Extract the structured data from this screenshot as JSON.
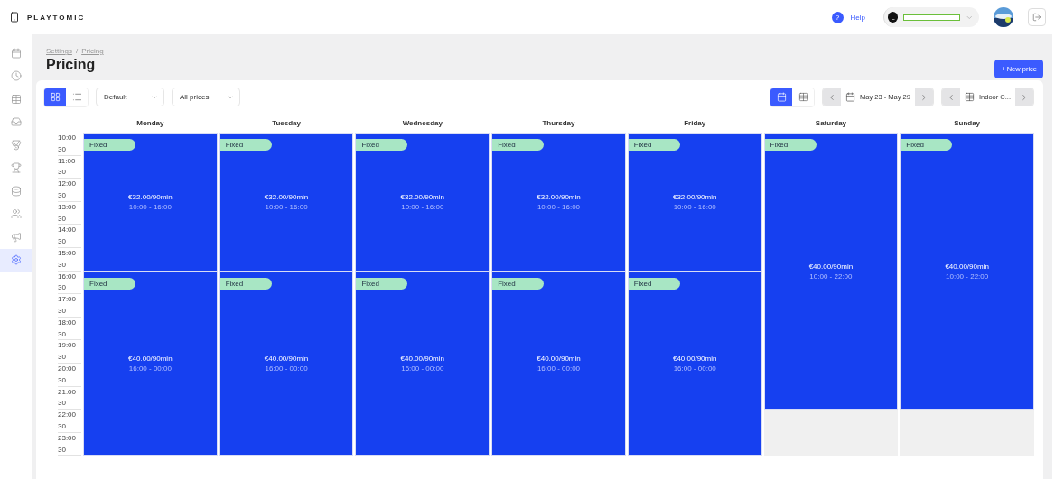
{
  "brand": {
    "name": "PLAYTOMIC"
  },
  "header": {
    "help": {
      "icon": "?",
      "label": "Help"
    },
    "account": {
      "initial": "L"
    }
  },
  "sidebar": {
    "items": [
      {
        "selected": false
      },
      {
        "selected": false
      },
      {
        "selected": false
      },
      {
        "selected": false
      },
      {
        "selected": false
      },
      {
        "selected": false
      },
      {
        "selected": false
      },
      {
        "selected": false
      },
      {
        "selected": false
      },
      {
        "selected": true
      }
    ]
  },
  "breadcrumb": {
    "items": [
      "Settings",
      "Pricing"
    ],
    "separator": "/"
  },
  "page_title": "Pricing",
  "new_button": "+ New price",
  "toolbar": {
    "view_modes": [
      {
        "selected": true
      },
      {
        "selected": false
      }
    ],
    "filters": [
      {
        "value": "Default"
      },
      {
        "value": "All prices"
      }
    ],
    "display_modes": [
      {
        "selected": true
      },
      {
        "selected": false
      }
    ],
    "date_range": "May 23 - May 29",
    "court": "Indoor C..."
  },
  "times": [
    "10:00",
    "30",
    "11:00",
    "30",
    "12:00",
    "30",
    "13:00",
    "30",
    "14:00",
    "30",
    "15:00",
    "30",
    "16:00",
    "30",
    "17:00",
    "30",
    "18:00",
    "30",
    "19:00",
    "30",
    "20:00",
    "30",
    "21:00",
    "30",
    "22:00",
    "30",
    "23:00",
    "30"
  ],
  "days": [
    {
      "name": "Monday",
      "slots": [
        {
          "tag": "Fixed",
          "price": "€32.00/90min",
          "range": "10:00 - 16:00"
        },
        {
          "tag": "Fixed",
          "price": "€40.00/90min",
          "range": "16:00 - 00:00"
        }
      ]
    },
    {
      "name": "Tuesday",
      "slots": [
        {
          "tag": "Fixed",
          "price": "€32.00/90min",
          "range": "10:00 - 16:00"
        },
        {
          "tag": "Fixed",
          "price": "€40.00/90min",
          "range": "16:00 - 00:00"
        }
      ]
    },
    {
      "name": "Wednesday",
      "slots": [
        {
          "tag": "Fixed",
          "price": "€32.00/90min",
          "range": "10:00 - 16:00"
        },
        {
          "tag": "Fixed",
          "price": "€40.00/90min",
          "range": "16:00 - 00:00"
        }
      ]
    },
    {
      "name": "Thursday",
      "slots": [
        {
          "tag": "Fixed",
          "price": "€32.00/90min",
          "range": "10:00 - 16:00"
        },
        {
          "tag": "Fixed",
          "price": "€40.00/90min",
          "range": "16:00 - 00:00"
        }
      ]
    },
    {
      "name": "Friday",
      "slots": [
        {
          "tag": "Fixed",
          "price": "€32.00/90min",
          "range": "10:00 - 16:00"
        },
        {
          "tag": "Fixed",
          "price": "€40.00/90min",
          "range": "16:00 - 00:00"
        }
      ]
    },
    {
      "name": "Saturday",
      "slots": [
        {
          "tag": "Fixed",
          "price": "€40.00/90min",
          "range": "10:00 - 22:00"
        }
      ]
    },
    {
      "name": "Sunday",
      "slots": [
        {
          "tag": "Fixed",
          "price": "€40.00/90min",
          "range": "10:00 - 22:00"
        }
      ]
    }
  ]
}
